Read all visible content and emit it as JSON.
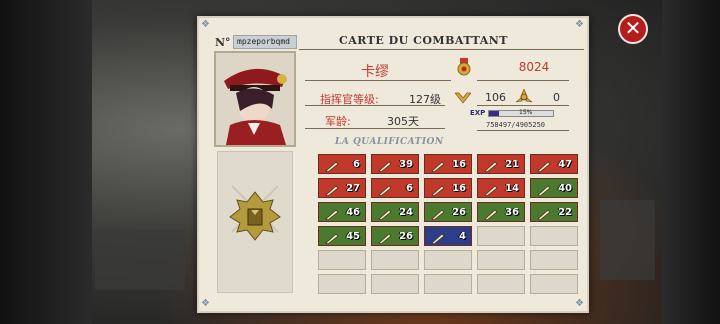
{
  "card": {
    "no_label": "N°",
    "serial": "mpzeporbqmd",
    "title": "CARTE DU COMBATTANT",
    "name": "卡缪",
    "power": "8024",
    "commander_level_label": "指挥官等级:",
    "commander_level_value": "127级",
    "rank_value": "106",
    "rank_value2": "0",
    "service_label": "军龄:",
    "service_value": "305天",
    "exp_label": "EXP",
    "exp_percent": "15%",
    "exp_fraction": 0.15,
    "exp_numbers": "758497/4905250",
    "qualification_title": "LA QUALIFICATION"
  },
  "qualifications": [
    {
      "value": "6",
      "color": "#c0392b",
      "icon": "rifle-icon"
    },
    {
      "value": "39",
      "color": "#c0392b",
      "icon": "smg-icon"
    },
    {
      "value": "16",
      "color": "#c0392b",
      "icon": "shell-icon"
    },
    {
      "value": "21",
      "color": "#c0392b",
      "icon": "rocket-icon"
    },
    {
      "value": "47",
      "color": "#c0392b",
      "icon": "sniper-icon"
    },
    {
      "value": "27",
      "color": "#c0392b",
      "icon": "pistol-icon"
    },
    {
      "value": "6",
      "color": "#c0392b",
      "icon": "grenade-icon"
    },
    {
      "value": "16",
      "color": "#c0392b",
      "icon": "bullet-icon"
    },
    {
      "value": "14",
      "color": "#c0392b",
      "icon": "wrench-icon"
    },
    {
      "value": "40",
      "color": "#4a7a2e",
      "icon": "ammo-crate-icon"
    },
    {
      "value": "46",
      "color": "#4a7a2e",
      "icon": "tank-icon"
    },
    {
      "value": "24",
      "color": "#4a7a2e",
      "icon": "armor-icon"
    },
    {
      "value": "26",
      "color": "#4a7a2e",
      "icon": "truck-icon"
    },
    {
      "value": "36",
      "color": "#4a7a2e",
      "icon": "apc-icon"
    },
    {
      "value": "22",
      "color": "#4a7a2e",
      "icon": "artillery-icon"
    },
    {
      "value": "45",
      "color": "#4a7a2e",
      "icon": "soldier-icon"
    },
    {
      "value": "26",
      "color": "#4a7a2e",
      "icon": "badge-icon"
    },
    {
      "value": "4",
      "color": "#2c3e8a",
      "icon": "flag-icon"
    }
  ],
  "close_button": {
    "symbol": "✕"
  }
}
